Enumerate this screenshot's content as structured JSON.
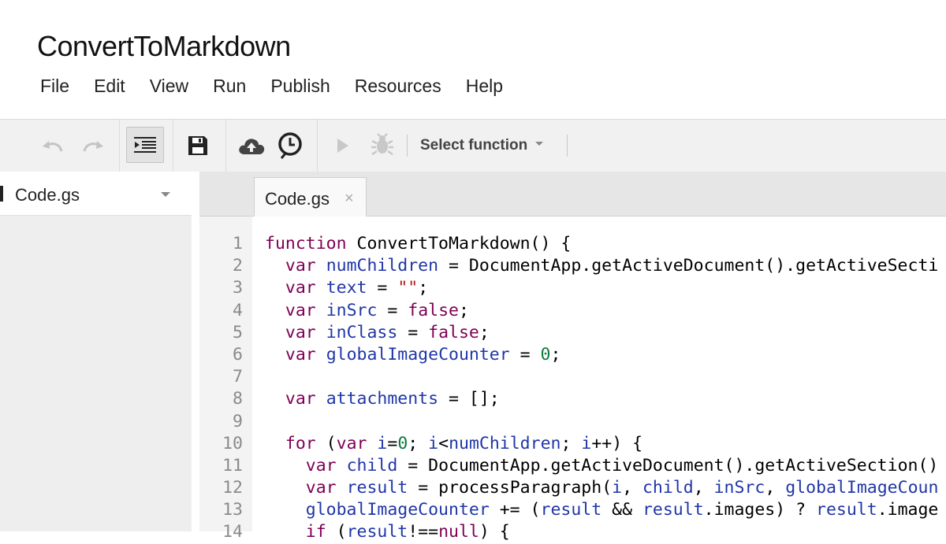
{
  "app": {
    "title": "ConvertToMarkdown"
  },
  "menu": [
    "File",
    "Edit",
    "View",
    "Run",
    "Publish",
    "Resources",
    "Help"
  ],
  "toolbar": {
    "icons": [
      "undo-icon",
      "redo-icon",
      "indent-icon",
      "save-icon",
      "cloud-upload-icon",
      "clock-icon",
      "run-icon",
      "debug-icon"
    ],
    "select_function": "Select function"
  },
  "sidebar": {
    "file": "Code.gs"
  },
  "tab": {
    "label": "Code.gs",
    "close": "×"
  },
  "editor": {
    "line_numbers": [
      "1",
      "2",
      "3",
      "4",
      "5",
      "6",
      "7",
      "8",
      "9",
      "10",
      "11",
      "12",
      "13",
      "14"
    ],
    "colors": {
      "keyword": "#7f0055",
      "identifier": "#1f36a8",
      "string": "#b21b1b",
      "number": "#0b7a3c"
    },
    "lines": [
      [
        [
          "kw",
          "function"
        ],
        [
          "p",
          " ConvertToMarkdown() {"
        ]
      ],
      [
        [
          "p",
          "  "
        ],
        [
          "kw",
          "var"
        ],
        [
          "p",
          " "
        ],
        [
          "id",
          "numChildren"
        ],
        [
          "p",
          " = DocumentApp.getActiveDocument().getActiveSecti"
        ]
      ],
      [
        [
          "p",
          "  "
        ],
        [
          "kw",
          "var"
        ],
        [
          "p",
          " "
        ],
        [
          "id",
          "text"
        ],
        [
          "p",
          " = "
        ],
        [
          "str",
          "\"\""
        ],
        [
          "p",
          ";"
        ]
      ],
      [
        [
          "p",
          "  "
        ],
        [
          "kw",
          "var"
        ],
        [
          "p",
          " "
        ],
        [
          "id",
          "inSrc"
        ],
        [
          "p",
          " = "
        ],
        [
          "kw",
          "false"
        ],
        [
          "p",
          ";"
        ]
      ],
      [
        [
          "p",
          "  "
        ],
        [
          "kw",
          "var"
        ],
        [
          "p",
          " "
        ],
        [
          "id",
          "inClass"
        ],
        [
          "p",
          " = "
        ],
        [
          "kw",
          "false"
        ],
        [
          "p",
          ";"
        ]
      ],
      [
        [
          "p",
          "  "
        ],
        [
          "kw",
          "var"
        ],
        [
          "p",
          " "
        ],
        [
          "id",
          "globalImageCounter"
        ],
        [
          "p",
          " = "
        ],
        [
          "num",
          "0"
        ],
        [
          "p",
          ";"
        ]
      ],
      [],
      [
        [
          "p",
          "  "
        ],
        [
          "kw",
          "var"
        ],
        [
          "p",
          " "
        ],
        [
          "id",
          "attachments"
        ],
        [
          "p",
          " = [];"
        ]
      ],
      [],
      [
        [
          "p",
          "  "
        ],
        [
          "kw",
          "for"
        ],
        [
          "p",
          " ("
        ],
        [
          "kw",
          "var"
        ],
        [
          "p",
          " "
        ],
        [
          "id",
          "i"
        ],
        [
          "p",
          "="
        ],
        [
          "num",
          "0"
        ],
        [
          "p",
          "; "
        ],
        [
          "id",
          "i"
        ],
        [
          "p",
          "<"
        ],
        [
          "id",
          "numChildren"
        ],
        [
          "p",
          "; "
        ],
        [
          "id",
          "i"
        ],
        [
          "p",
          "++) {"
        ]
      ],
      [
        [
          "p",
          "    "
        ],
        [
          "kw",
          "var"
        ],
        [
          "p",
          " "
        ],
        [
          "id",
          "child"
        ],
        [
          "p",
          " = DocumentApp.getActiveDocument().getActiveSection()"
        ]
      ],
      [
        [
          "p",
          "    "
        ],
        [
          "kw",
          "var"
        ],
        [
          "p",
          " "
        ],
        [
          "id",
          "result"
        ],
        [
          "p",
          " = processParagraph("
        ],
        [
          "id",
          "i"
        ],
        [
          "p",
          ", "
        ],
        [
          "id",
          "child"
        ],
        [
          "p",
          ", "
        ],
        [
          "id",
          "inSrc"
        ],
        [
          "p",
          ", "
        ],
        [
          "id",
          "globalImageCoun"
        ]
      ],
      [
        [
          "p",
          "    "
        ],
        [
          "id",
          "globalImageCounter"
        ],
        [
          "p",
          " += ("
        ],
        [
          "id",
          "result"
        ],
        [
          "p",
          " && "
        ],
        [
          "id",
          "result"
        ],
        [
          "p",
          ".images) ? "
        ],
        [
          "id",
          "result"
        ],
        [
          "p",
          ".image"
        ]
      ],
      [
        [
          "p",
          "    "
        ],
        [
          "kw",
          "if"
        ],
        [
          "p",
          " ("
        ],
        [
          "id",
          "result"
        ],
        [
          "p",
          "!=="
        ],
        [
          "kw",
          "null"
        ],
        [
          "p",
          ") {"
        ]
      ]
    ]
  }
}
